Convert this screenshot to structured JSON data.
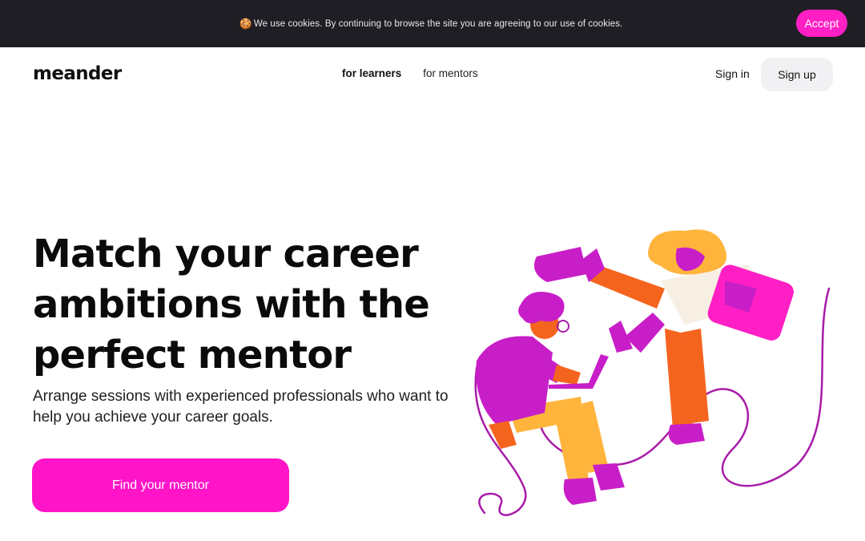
{
  "cookie_bar": {
    "icon": "cookie-icon",
    "message": "We use cookies. By continuing to browse the site you are agreeing to our use of cookies.",
    "accept_label": "Accept"
  },
  "header": {
    "logo": "meander",
    "nav": [
      {
        "label": "for learners",
        "active": true
      },
      {
        "label": "for mentors",
        "active": false
      }
    ],
    "signin_label": "Sign in",
    "signup_label": "Sign up"
  },
  "hero": {
    "title": "Match your career ambitions with the perfect mentor",
    "subtitle": "Arrange sessions with experienced professionals who want to help you achieve your career goals.",
    "cta_label": "Find your mentor"
  },
  "colors": {
    "accent": "#ff14c8",
    "dark_bar": "#1e1e24",
    "purple": "#c81ec8",
    "orange": "#f5641e",
    "yellow": "#ffb43c"
  }
}
